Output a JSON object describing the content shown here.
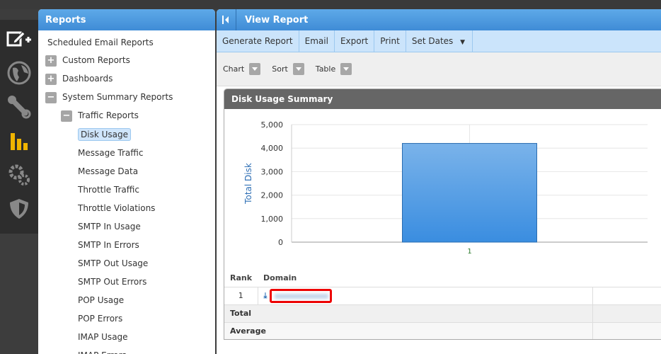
{
  "left_panel": {
    "title": "Reports",
    "items": [
      {
        "label": "Scheduled Email Reports",
        "level": 0,
        "toggle": ""
      },
      {
        "label": "Custom Reports",
        "level": 1,
        "toggle": "+"
      },
      {
        "label": "Dashboards",
        "level": 1,
        "toggle": "+"
      },
      {
        "label": "System Summary Reports",
        "level": 1,
        "toggle": "−"
      },
      {
        "label": "Traffic Reports",
        "level": 2,
        "toggle": "−"
      },
      {
        "label": "Disk Usage",
        "level": 3,
        "selected": true
      },
      {
        "label": "Message Traffic",
        "level": 3
      },
      {
        "label": "Message Data",
        "level": 3
      },
      {
        "label": "Throttle Traffic",
        "level": 3
      },
      {
        "label": "Throttle Violations",
        "level": 3
      },
      {
        "label": "SMTP In Usage",
        "level": 3
      },
      {
        "label": "SMTP In Errors",
        "level": 3
      },
      {
        "label": "SMTP Out Usage",
        "level": 3
      },
      {
        "label": "SMTP Out Errors",
        "level": 3
      },
      {
        "label": "POP Usage",
        "level": 3
      },
      {
        "label": "POP Errors",
        "level": 3
      },
      {
        "label": "IMAP Usage",
        "level": 3
      },
      {
        "label": "IMAP Errors",
        "level": 3
      }
    ]
  },
  "right_panel": {
    "title": "View Report",
    "toolbar": [
      "Generate Report",
      "Email",
      "Export",
      "Print",
      "Set Dates"
    ],
    "options": [
      "Chart",
      "Sort",
      "Table"
    ],
    "card_title": "Disk Usage Summary",
    "table": {
      "headers": [
        "Rank",
        "Domain"
      ],
      "rows": [
        {
          "rank": "1"
        }
      ],
      "total_label": "Total",
      "average_label": "Average"
    }
  },
  "chart_data": {
    "type": "bar",
    "categories": [
      "1"
    ],
    "values": [
      4200
    ],
    "title": "",
    "xlabel": "",
    "ylabel": "Total Disk",
    "ylim": [
      0,
      5000
    ],
    "yticks": [
      "0",
      "1,000",
      "2,000",
      "3,000",
      "4,000",
      "5,000"
    ],
    "grid": true,
    "bar_color": "#3a8de0"
  }
}
